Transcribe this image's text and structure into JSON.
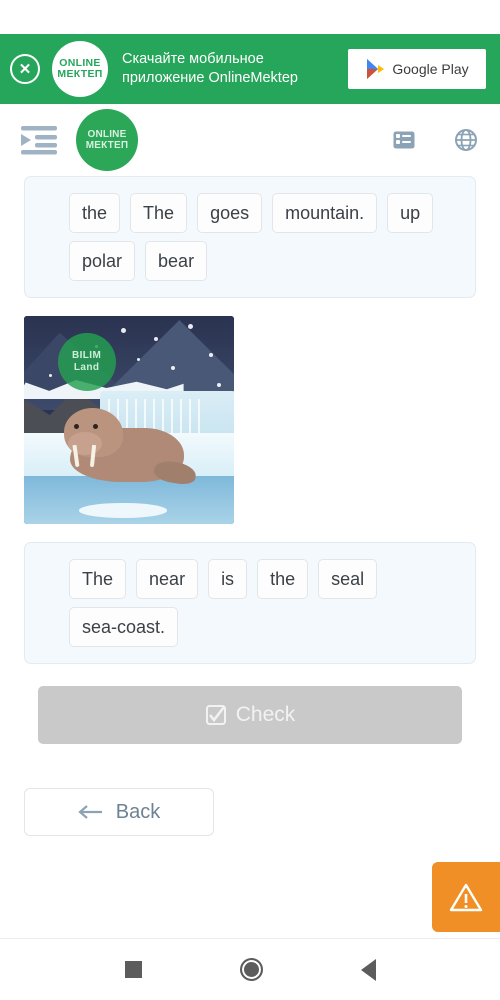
{
  "promo_banner": {
    "close_icon": "close-circle-icon",
    "logo_line1": "ONLINE",
    "logo_line2": "МЕКТЕП",
    "text_line1": "Скачайте мобильное",
    "text_line2": "приложение OnlineMektep",
    "store_button_label": "Google Play",
    "store_icon": "google-play-icon",
    "background_color": "#26A65B"
  },
  "header": {
    "menu_icon": "indent-sidebar-icon",
    "logo_line1": "ONLINE",
    "logo_line2": "МЕКТЕП",
    "tasks_icon": "task-list-icon",
    "language_icon": "globe-icon",
    "logo_color": "#2BA757",
    "icon_color": "#8ca3b5"
  },
  "exercise": {
    "card_one": {
      "tiles": [
        "the",
        "The",
        "goes",
        "mountain.",
        "up",
        "polar",
        "bear"
      ]
    },
    "illustration": {
      "alt": "walrus-on-ice-illustration",
      "watermark_line1": "BILIM",
      "watermark_line2": "Land"
    },
    "card_two": {
      "tiles": [
        "The",
        "near",
        "is",
        "the",
        "seal",
        "sea-coast."
      ]
    },
    "check_button": {
      "label": "Check",
      "icon": "checkbox-checked-icon",
      "enabled": false,
      "color": "#c9c9c9"
    },
    "back_button": {
      "label": "Back",
      "icon": "arrow-left-icon"
    },
    "warning_button": {
      "icon": "warning-triangle-icon",
      "color": "#ef8f26"
    }
  },
  "system_nav": {
    "recents_icon": "square-recents-icon",
    "home_icon": "circle-home-icon",
    "back_icon": "triangle-back-icon"
  }
}
